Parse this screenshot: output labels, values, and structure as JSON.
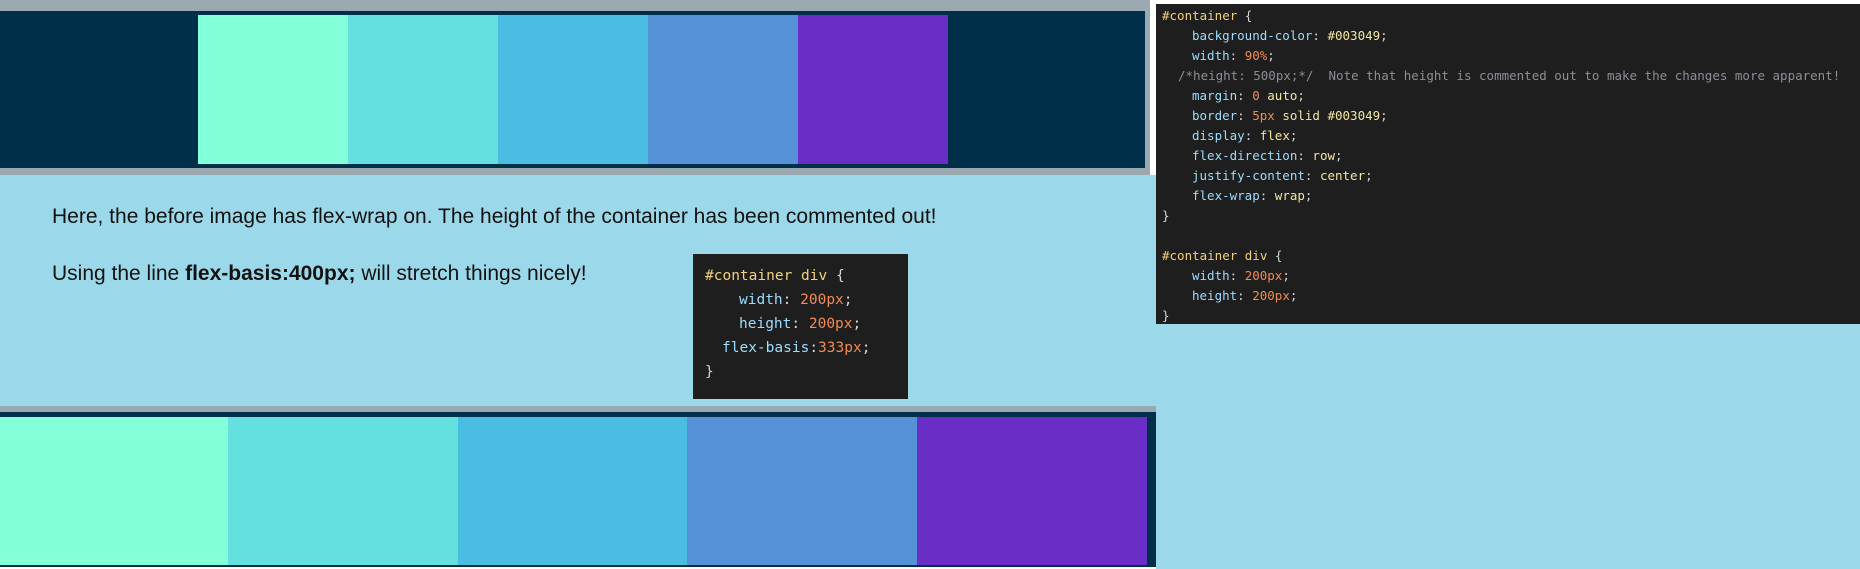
{
  "colors": {
    "container_bg": "#003049",
    "swatches": [
      "#83ffd9",
      "#64e1de",
      "#4abde2",
      "#5692d8",
      "#6a2ec6"
    ],
    "band_bg": "#9bd9ea"
  },
  "explanation": {
    "line1": "Here, the before image has flex-wrap on.  The height of the container has been commented out!",
    "line2_prefix": "Using the line ",
    "line2_bold": "flex-basis:400px;",
    "line2_suffix": " will stretch things nicely!"
  },
  "snippet": {
    "selector": "#container div",
    "open": " {",
    "width_prop": "width",
    "width_val": "200px",
    "height_prop": "height",
    "height_val": "200px",
    "basis_prop": "flex-basis",
    "basis_val": "333px",
    "close": "}"
  },
  "code_panel": {
    "sel1": "#container",
    "l_bg_prop": "background-color",
    "l_bg_val": "#003049",
    "l_width_prop": "width",
    "l_width_val": "90%",
    "l_comment": "/*height: 500px;*/  Note that height is commented out to make the changes more apparent!",
    "l_margin_prop": "margin",
    "l_margin_num": "0",
    "l_margin_rest": "auto",
    "l_border_prop": "border",
    "l_border_num": "5px",
    "l_border_rest": "solid #003049",
    "l_display_prop": "display",
    "l_display_val": "flex",
    "l_dir_prop": "flex-direction",
    "l_dir_val": "row",
    "l_justify_prop": "justify-content",
    "l_justify_val": "center",
    "l_wrap_prop": "flex-wrap",
    "l_wrap_val": "wrap",
    "sel2": "#container div",
    "l2_width_prop": "width",
    "l2_width_val": "200px",
    "l2_height_prop": "height",
    "l2_height_val": "200px",
    "open": " {",
    "close": "}"
  }
}
